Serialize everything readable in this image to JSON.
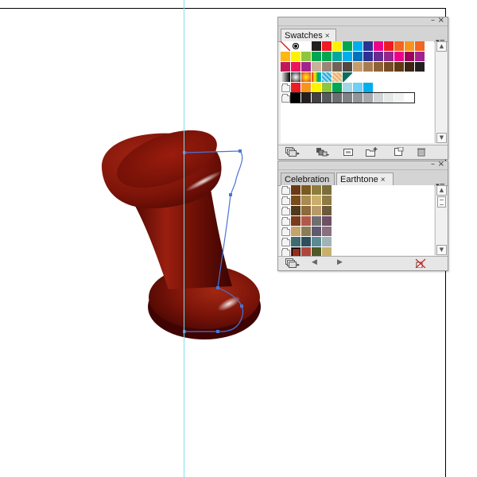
{
  "swatches_panel": {
    "tab_label": "Swatches",
    "tab_close": "×",
    "minimize": "–",
    "close": "×",
    "menu": "▾≡",
    "rows": [
      [
        "none",
        "registration",
        "#ffffff",
        "#231f20",
        "#ed1c24",
        "#fff200",
        "#00a651",
        "#00aeef",
        "#2e3192",
        "#ec008c",
        "#ed1c24",
        "#f26522",
        "#f7941d",
        "#f26522"
      ],
      [
        "#fdb813",
        "#fff200",
        "#8dc63f",
        "#00a651",
        "#00a651",
        "#00a99d",
        "#00aeef",
        "#0072bc",
        "#2e3192",
        "#662d91",
        "#92278f",
        "#ec008c",
        "#9e005d",
        "#a3238e"
      ],
      [
        "#c2185b",
        "#ed145b",
        "#a3238e",
        "#c7b299",
        "#998675",
        "#736357",
        "#534741",
        "#c69c6d",
        "#a67c52",
        "#8c6239",
        "#754c24",
        "#603913",
        "#3c2415",
        "#231f20"
      ],
      [
        "gradient-black",
        "gradient-radial",
        "gradient-orange",
        "gradient-rainbow",
        "pattern-blue",
        "pattern-tan",
        "fill-teal-swatch"
      ],
      [
        "folder",
        "#ed1c24",
        "#f7941d",
        "#fff200",
        "#8dc63f",
        "#00a651",
        "#a0d6e6",
        "#6dcff6",
        "#00aeef"
      ],
      [
        "folder",
        "#000000",
        "#231f20",
        "#414042",
        "#58595b",
        "#6d6e71",
        "#808285",
        "#939598",
        "#a7a9ac",
        "#d1d3d4",
        "#e6e7e8",
        "#f1f2f2"
      ]
    ]
  },
  "color_group_panel": {
    "tabs": [
      {
        "label": "Celebration"
      },
      {
        "label": "Earthtone",
        "close": "×"
      }
    ],
    "minimize": "–",
    "close": "×",
    "menu": "▾≡",
    "scroll_up": "▲",
    "scroll_down": "▼",
    "nav_prev": "◀",
    "nav_next": "▶",
    "rows": [
      [
        "#6b3a12",
        "#7b5a1f",
        "#8e7d3c",
        "#7a6e3a"
      ],
      [
        "#7a4c1c",
        "#a88b4e",
        "#c9ae6b",
        "#8d7a45"
      ],
      [
        "#4f3a1a",
        "#8c6a3c",
        "#b89a6a",
        "#6d5a3a"
      ],
      [
        "#7b3b1b",
        "#b0584a",
        "#6f6f6f",
        "#6e4f63"
      ],
      [
        "#c4a46b",
        "#8c7b59",
        "#5f5a6e",
        "#8a6f7e"
      ],
      [
        "#3f6b6e",
        "#2e4e5e",
        "#5c8a94",
        "#9fb4b7"
      ],
      [
        "#9b2a1a",
        "#b0453a",
        "#4e5a2a",
        "#c8b06a"
      ],
      [
        "#c9b49a",
        "#a89a7a",
        "#8e8a6a",
        "#6a6a5a"
      ]
    ]
  },
  "colors": {
    "guide": "#7fe0ee",
    "path": "#4a74d4",
    "object": "#8b1408"
  }
}
